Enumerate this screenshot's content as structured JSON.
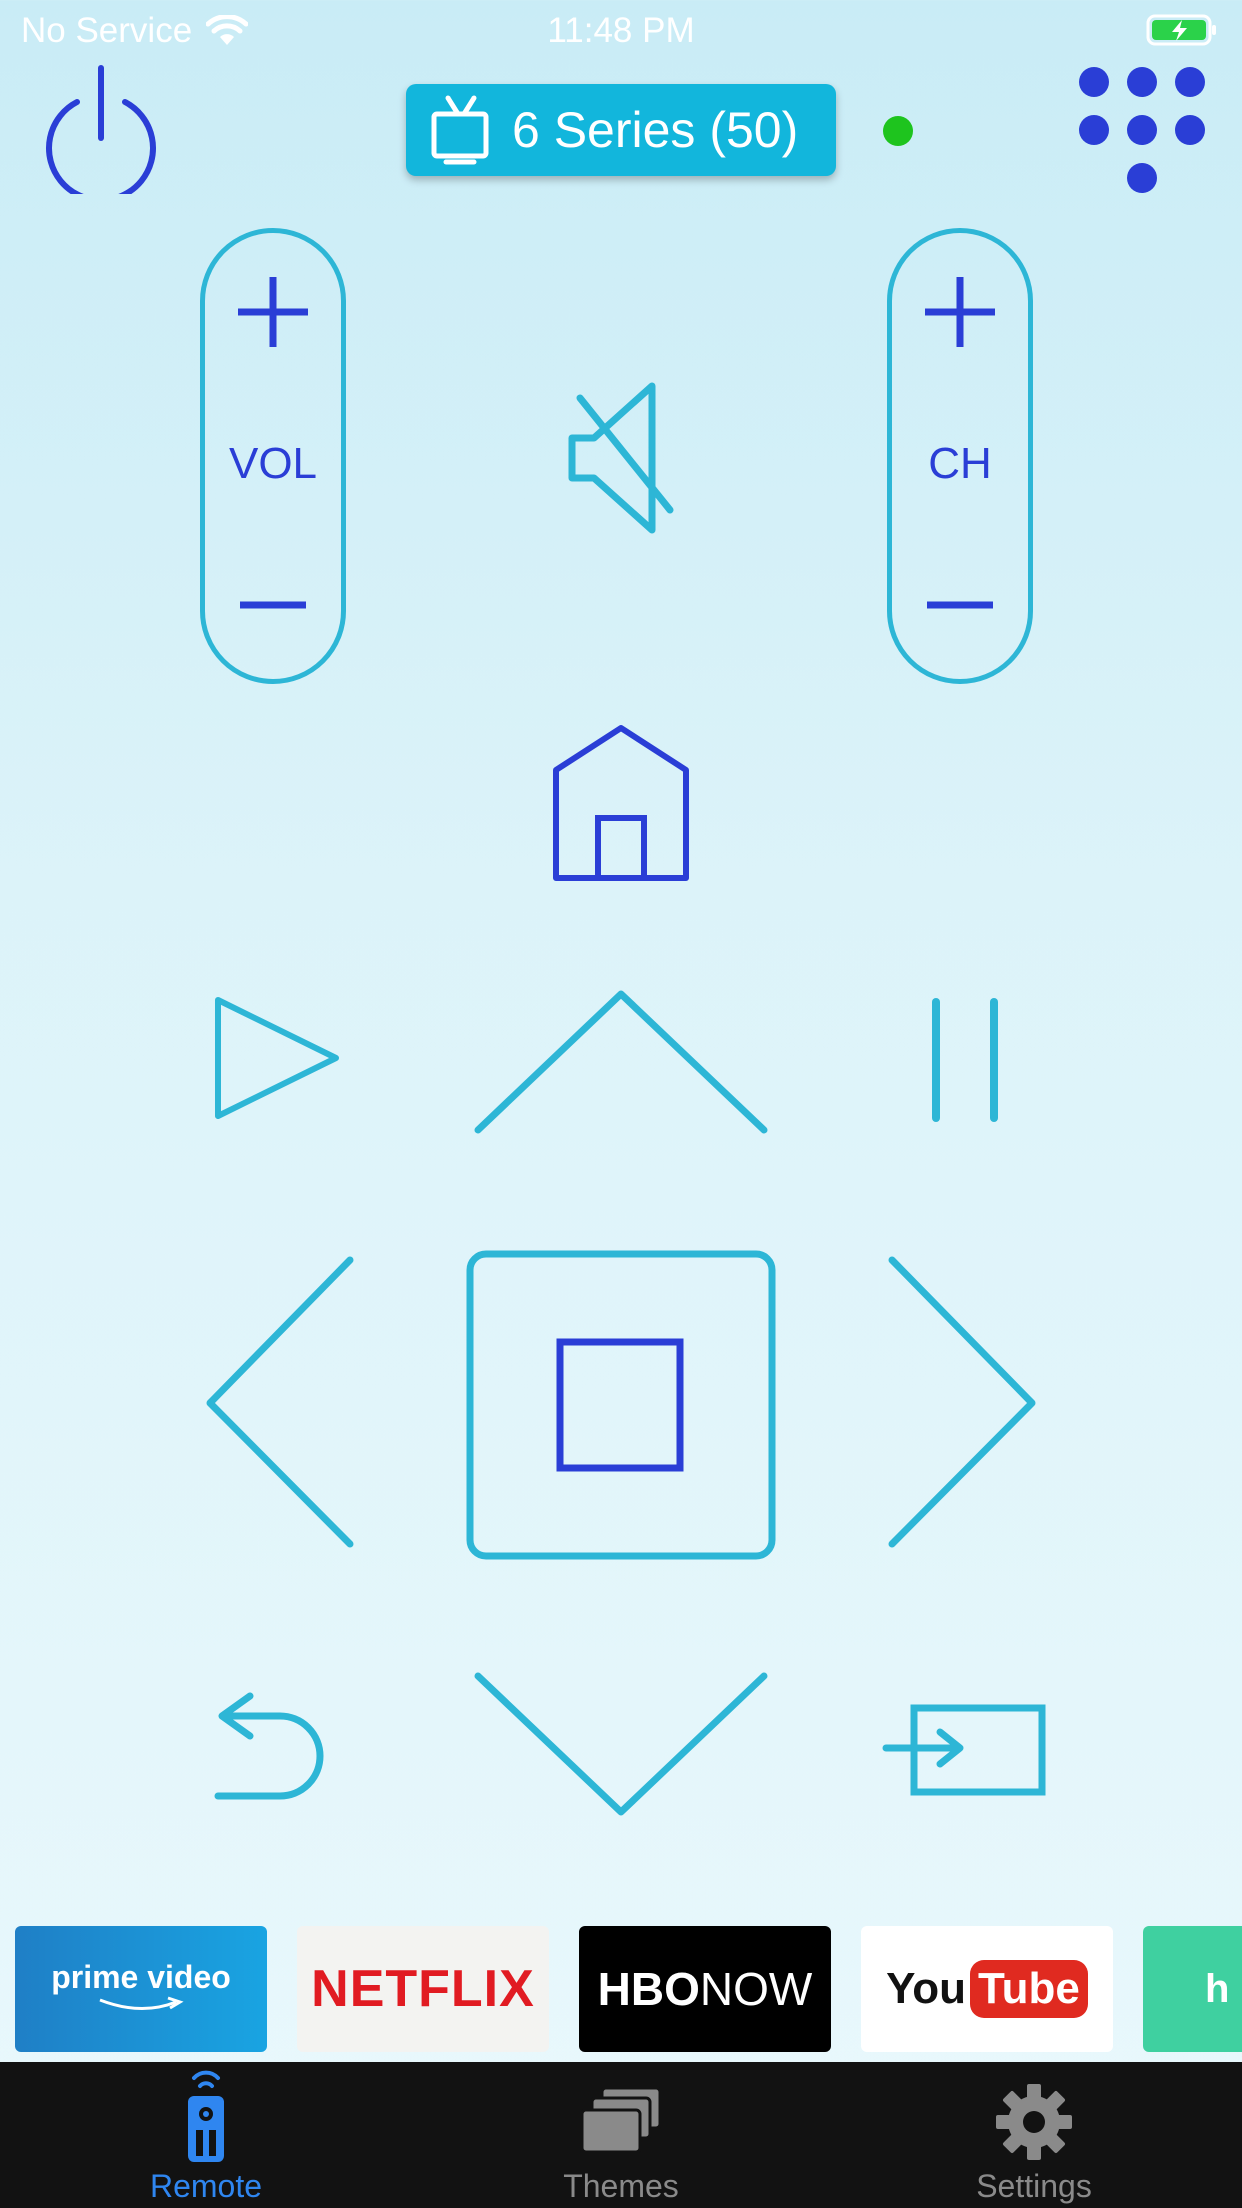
{
  "status_bar": {
    "carrier": "No Service",
    "time": "11:48 PM"
  },
  "device": {
    "name": "6 Series (50)",
    "connected_color": "#1ec41e"
  },
  "volume": {
    "label": "VOL"
  },
  "channel": {
    "label": "CH"
  },
  "apps": [
    {
      "name": "prime video"
    },
    {
      "name": "NETFLIX"
    },
    {
      "name": "HBO",
      "suffix": "NOW"
    },
    {
      "name_you": "You",
      "name_tube": "Tube"
    },
    {
      "name": "h"
    }
  ],
  "tabs": [
    {
      "label": "Remote",
      "active": true
    },
    {
      "label": "Themes",
      "active": false
    },
    {
      "label": "Settings",
      "active": false
    }
  ],
  "colors": {
    "accent_blue": "#2a3ed6",
    "accent_cyan": "#2db6d6",
    "tab_active": "#2f86f0",
    "tab_inactive": "#8a8a8a"
  }
}
